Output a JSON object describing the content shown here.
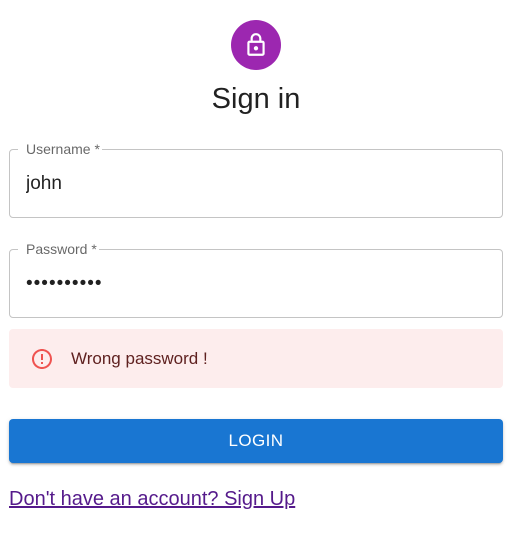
{
  "colors": {
    "avatar_bg": "#9c27b0",
    "primary": "#1976d2",
    "alert_bg": "#fdeded",
    "alert_icon": "#ef5350",
    "alert_text": "#5f2120",
    "link": "#551a8b"
  },
  "header": {
    "avatar_icon": "lock-outlined-icon",
    "title": "Sign in"
  },
  "form": {
    "username": {
      "label": "Username *",
      "value": "john"
    },
    "password": {
      "label": "Password *",
      "value": "••••••••••"
    },
    "alert": {
      "icon": "error-outline-icon",
      "message": "Wrong password !"
    },
    "login_label": "Login",
    "signup_link": "Don't have an account? Sign Up"
  }
}
